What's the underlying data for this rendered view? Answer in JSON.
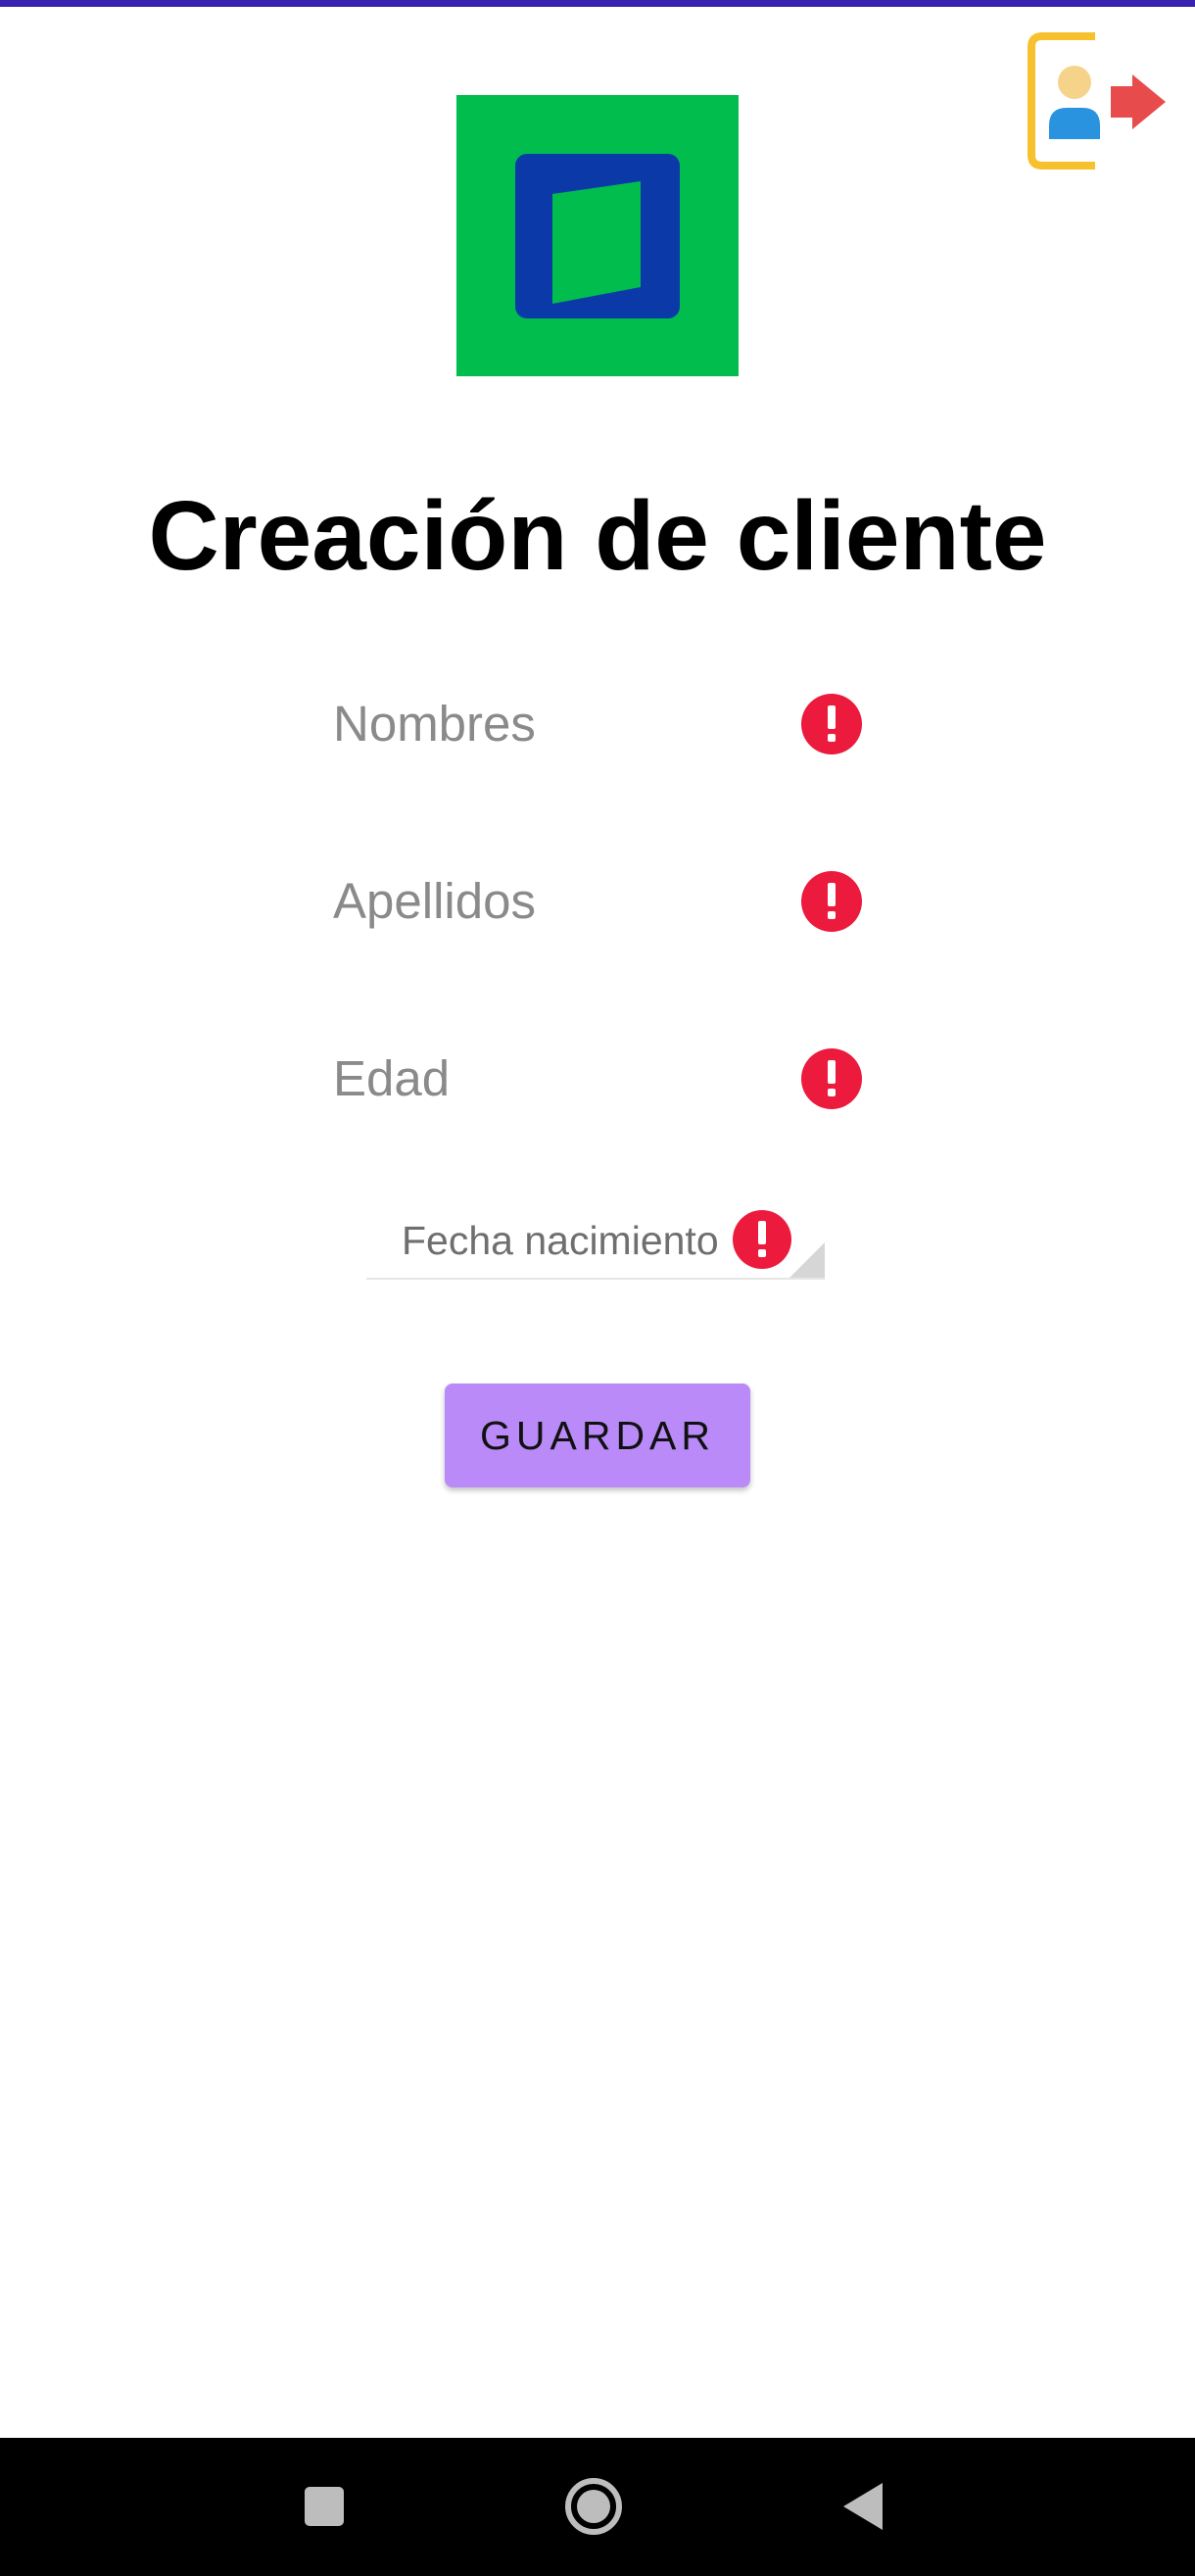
{
  "header": {
    "logo_icon": "app-logo-icon",
    "logout_icon": "logout-icon"
  },
  "title": "Creación de cliente",
  "form": {
    "fields": [
      {
        "placeholder": "Nombres",
        "error_icon": "error-icon"
      },
      {
        "placeholder": "Apellidos",
        "error_icon": "error-icon"
      },
      {
        "placeholder": "Edad",
        "error_icon": "error-icon"
      }
    ],
    "birth_date": {
      "label": "Fecha nacimiento",
      "error_icon": "error-icon"
    },
    "save_label": "GUARDAR"
  },
  "navigation": {
    "recents_icon": "square-icon",
    "home_icon": "circle-icon",
    "back_icon": "triangle-back-icon"
  },
  "colors": {
    "status_strip": "#3a22b0",
    "logo_green": "#00bd4d",
    "logo_blue": "#0b3aa8",
    "error": "#ec1a3c",
    "button": "#b98af8"
  }
}
